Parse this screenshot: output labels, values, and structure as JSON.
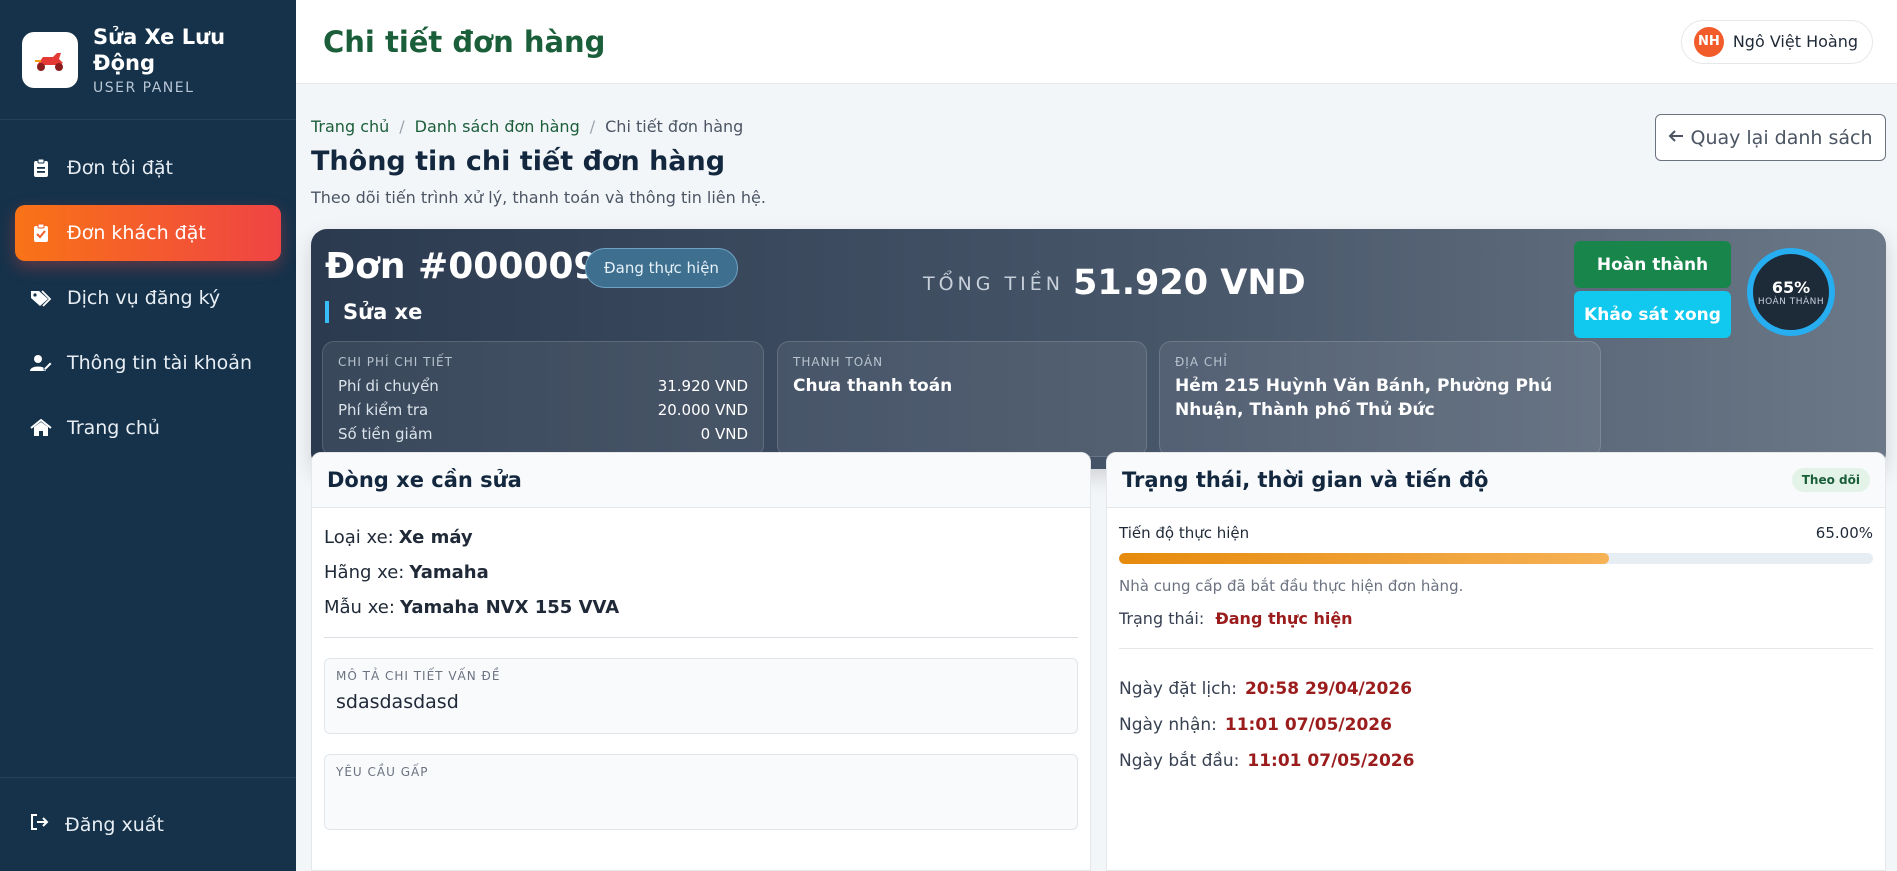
{
  "brand": {
    "title": "Sửa Xe Lưu Động",
    "subtitle": "USER PANEL"
  },
  "nav": [
    {
      "label": "Đơn tôi đặt",
      "icon": "clipboard-list-icon",
      "active": false
    },
    {
      "label": "Đơn khách đặt",
      "icon": "clipboard-check-icon",
      "active": true
    },
    {
      "label": "Dịch vụ đăng ký",
      "icon": "tags-icon",
      "active": false
    },
    {
      "label": "Thông tin tài khoản",
      "icon": "user-edit-icon",
      "active": false
    },
    {
      "label": "Trang chủ",
      "icon": "home-icon",
      "active": false
    }
  ],
  "logout_label": "Đăng xuất",
  "topbar": {
    "title": "Chi tiết đơn hàng",
    "user_initials": "NH",
    "user_name": "Ngô Việt Hoàng"
  },
  "breadcrumb": [
    "Trang chủ",
    "Danh sách đơn hàng",
    "Chi tiết đơn hàng"
  ],
  "page": {
    "title": "Thông tin chi tiết đơn hàng",
    "subtitle": "Theo dõi tiến trình xử lý, thanh toán và thông tin liên hệ.",
    "back_label": "Quay lại danh sách"
  },
  "order": {
    "number": "Đơn #0000092",
    "status": "Đang thực hiện",
    "service": "Sửa xe",
    "total_label": "TỔNG TIỀN",
    "total_value": "51.920 VND",
    "done_label": "Hoàn thành",
    "survey_label": "Khảo sát xong",
    "progress_pct_text": "65%",
    "progress_ring_label": "HOÀN THÀNH",
    "fees": {
      "label": "CHI PHÍ CHI TIẾT",
      "rows": [
        {
          "name": "Phí di chuyển",
          "value": "31.920 VND"
        },
        {
          "name": "Phí kiểm tra",
          "value": "20.000 VND"
        },
        {
          "name": "Số tiền giảm",
          "value": "0 VND"
        }
      ]
    },
    "payment": {
      "label": "THANH TOÁN",
      "value": "Chưa thanh toán"
    },
    "address": {
      "label": "ĐỊA CHỈ",
      "value": "Hẻm 215 Huỳnh Văn Bánh, Phường Phú Nhuận, Thành phố Thủ Đức"
    }
  },
  "vehicle": {
    "title": "Dòng xe cần sửa",
    "type_label": "Loại xe:",
    "type_value": "Xe máy",
    "brand_label": "Hãng xe:",
    "brand_value": "Yamaha",
    "model_label": "Mẫu xe:",
    "model_value": "Yamaha NVX 155 VVA",
    "desc_label": "MÔ TẢ CHI TIẾT VẤN ĐỀ",
    "desc_value": "sdasdasdasd",
    "urgent_label": "YÊU CẦU GẤP"
  },
  "status_panel": {
    "title": "Trạng thái, thời gian và tiến độ",
    "badge": "Theo dõi",
    "progress_label": "Tiến độ thực hiện",
    "progress_text": "65.00%",
    "progress_value": 65,
    "progress_note": "Nhà cung cấp đã bắt đầu thực hiện đơn hàng.",
    "state_label": "Trạng thái:",
    "state_value": "Đang thực hiện",
    "dates": [
      {
        "label": "Ngày đặt lịch:",
        "value": "20:58 29/04/2026"
      },
      {
        "label": "Ngày nhận:",
        "value": "11:01 07/05/2026"
      },
      {
        "label": "Ngày bắt đầu:",
        "value": "11:01 07/05/2026"
      }
    ]
  }
}
